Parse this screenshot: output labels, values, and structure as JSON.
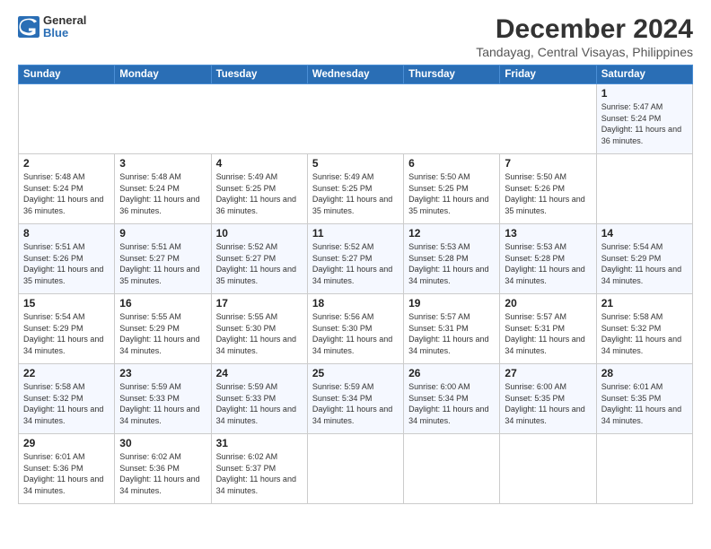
{
  "app": {
    "logo_general": "General",
    "logo_blue": "Blue"
  },
  "header": {
    "title": "December 2024",
    "location": "Tandayag, Central Visayas, Philippines"
  },
  "calendar": {
    "days_of_week": [
      "Sunday",
      "Monday",
      "Tuesday",
      "Wednesday",
      "Thursday",
      "Friday",
      "Saturday"
    ],
    "weeks": [
      [
        null,
        null,
        null,
        null,
        null,
        null,
        {
          "day": 1,
          "sunrise": "Sunrise: 5:47 AM",
          "sunset": "Sunset: 5:24 PM",
          "daylight": "Daylight: 11 hours and 36 minutes."
        }
      ],
      [
        {
          "day": 2,
          "sunrise": "Sunrise: 5:48 AM",
          "sunset": "Sunset: 5:24 PM",
          "daylight": "Daylight: 11 hours and 36 minutes."
        },
        {
          "day": 3,
          "sunrise": "Sunrise: 5:48 AM",
          "sunset": "Sunset: 5:24 PM",
          "daylight": "Daylight: 11 hours and 36 minutes."
        },
        {
          "day": 4,
          "sunrise": "Sunrise: 5:49 AM",
          "sunset": "Sunset: 5:25 PM",
          "daylight": "Daylight: 11 hours and 36 minutes."
        },
        {
          "day": 5,
          "sunrise": "Sunrise: 5:49 AM",
          "sunset": "Sunset: 5:25 PM",
          "daylight": "Daylight: 11 hours and 35 minutes."
        },
        {
          "day": 6,
          "sunrise": "Sunrise: 5:50 AM",
          "sunset": "Sunset: 5:25 PM",
          "daylight": "Daylight: 11 hours and 35 minutes."
        },
        {
          "day": 7,
          "sunrise": "Sunrise: 5:50 AM",
          "sunset": "Sunset: 5:26 PM",
          "daylight": "Daylight: 11 hours and 35 minutes."
        }
      ],
      [
        {
          "day": 8,
          "sunrise": "Sunrise: 5:51 AM",
          "sunset": "Sunset: 5:26 PM",
          "daylight": "Daylight: 11 hours and 35 minutes."
        },
        {
          "day": 9,
          "sunrise": "Sunrise: 5:51 AM",
          "sunset": "Sunset: 5:27 PM",
          "daylight": "Daylight: 11 hours and 35 minutes."
        },
        {
          "day": 10,
          "sunrise": "Sunrise: 5:52 AM",
          "sunset": "Sunset: 5:27 PM",
          "daylight": "Daylight: 11 hours and 35 minutes."
        },
        {
          "day": 11,
          "sunrise": "Sunrise: 5:52 AM",
          "sunset": "Sunset: 5:27 PM",
          "daylight": "Daylight: 11 hours and 34 minutes."
        },
        {
          "day": 12,
          "sunrise": "Sunrise: 5:53 AM",
          "sunset": "Sunset: 5:28 PM",
          "daylight": "Daylight: 11 hours and 34 minutes."
        },
        {
          "day": 13,
          "sunrise": "Sunrise: 5:53 AM",
          "sunset": "Sunset: 5:28 PM",
          "daylight": "Daylight: 11 hours and 34 minutes."
        },
        {
          "day": 14,
          "sunrise": "Sunrise: 5:54 AM",
          "sunset": "Sunset: 5:29 PM",
          "daylight": "Daylight: 11 hours and 34 minutes."
        }
      ],
      [
        {
          "day": 15,
          "sunrise": "Sunrise: 5:54 AM",
          "sunset": "Sunset: 5:29 PM",
          "daylight": "Daylight: 11 hours and 34 minutes."
        },
        {
          "day": 16,
          "sunrise": "Sunrise: 5:55 AM",
          "sunset": "Sunset: 5:29 PM",
          "daylight": "Daylight: 11 hours and 34 minutes."
        },
        {
          "day": 17,
          "sunrise": "Sunrise: 5:55 AM",
          "sunset": "Sunset: 5:30 PM",
          "daylight": "Daylight: 11 hours and 34 minutes."
        },
        {
          "day": 18,
          "sunrise": "Sunrise: 5:56 AM",
          "sunset": "Sunset: 5:30 PM",
          "daylight": "Daylight: 11 hours and 34 minutes."
        },
        {
          "day": 19,
          "sunrise": "Sunrise: 5:57 AM",
          "sunset": "Sunset: 5:31 PM",
          "daylight": "Daylight: 11 hours and 34 minutes."
        },
        {
          "day": 20,
          "sunrise": "Sunrise: 5:57 AM",
          "sunset": "Sunset: 5:31 PM",
          "daylight": "Daylight: 11 hours and 34 minutes."
        },
        {
          "day": 21,
          "sunrise": "Sunrise: 5:58 AM",
          "sunset": "Sunset: 5:32 PM",
          "daylight": "Daylight: 11 hours and 34 minutes."
        }
      ],
      [
        {
          "day": 22,
          "sunrise": "Sunrise: 5:58 AM",
          "sunset": "Sunset: 5:32 PM",
          "daylight": "Daylight: 11 hours and 34 minutes."
        },
        {
          "day": 23,
          "sunrise": "Sunrise: 5:59 AM",
          "sunset": "Sunset: 5:33 PM",
          "daylight": "Daylight: 11 hours and 34 minutes."
        },
        {
          "day": 24,
          "sunrise": "Sunrise: 5:59 AM",
          "sunset": "Sunset: 5:33 PM",
          "daylight": "Daylight: 11 hours and 34 minutes."
        },
        {
          "day": 25,
          "sunrise": "Sunrise: 5:59 AM",
          "sunset": "Sunset: 5:34 PM",
          "daylight": "Daylight: 11 hours and 34 minutes."
        },
        {
          "day": 26,
          "sunrise": "Sunrise: 6:00 AM",
          "sunset": "Sunset: 5:34 PM",
          "daylight": "Daylight: 11 hours and 34 minutes."
        },
        {
          "day": 27,
          "sunrise": "Sunrise: 6:00 AM",
          "sunset": "Sunset: 5:35 PM",
          "daylight": "Daylight: 11 hours and 34 minutes."
        },
        {
          "day": 28,
          "sunrise": "Sunrise: 6:01 AM",
          "sunset": "Sunset: 5:35 PM",
          "daylight": "Daylight: 11 hours and 34 minutes."
        }
      ],
      [
        {
          "day": 29,
          "sunrise": "Sunrise: 6:01 AM",
          "sunset": "Sunset: 5:36 PM",
          "daylight": "Daylight: 11 hours and 34 minutes."
        },
        {
          "day": 30,
          "sunrise": "Sunrise: 6:02 AM",
          "sunset": "Sunset: 5:36 PM",
          "daylight": "Daylight: 11 hours and 34 minutes."
        },
        {
          "day": 31,
          "sunrise": "Sunrise: 6:02 AM",
          "sunset": "Sunset: 5:37 PM",
          "daylight": "Daylight: 11 hours and 34 minutes."
        },
        null,
        null,
        null,
        null
      ]
    ]
  }
}
